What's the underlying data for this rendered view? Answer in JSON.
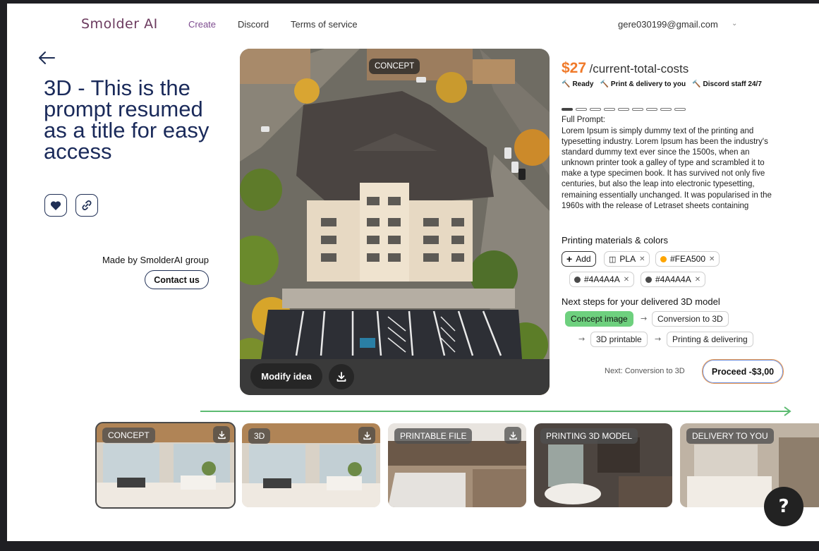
{
  "nav": {
    "logo": "Smolder AI",
    "links": [
      "Create",
      "Discord",
      "Terms of service"
    ],
    "user_email": "gere030199@gmail.com"
  },
  "project": {
    "title": "3D - This is the prompt resumed as a title for easy access",
    "made_by": "Made by SmolderAI group",
    "contact_label": "Contact us"
  },
  "hero": {
    "tag": "CONCEPT",
    "modify_label": "Modify idea"
  },
  "pricing": {
    "amount": "$27",
    "label": "/current-total-costs",
    "features": [
      "Ready",
      "Print & delivery to you",
      "Discord staff 24/7"
    ]
  },
  "prompt": {
    "label": "Full Prompt:",
    "text": "Lorem Ipsum is simply dummy text of the printing and typesetting industry. Lorem Ipsum has been the industry's standard dummy text ever since the 1500s, when an unknown printer took a galley of type and scrambled it to make a type specimen book. It has survived not only five centuries, but also the leap into electronic typesetting, remaining essentially unchanged. It was popularised in the 1960s with the release of Letraset sheets containing"
  },
  "materials": {
    "title": "Printing materials & colors",
    "add_label": "Add",
    "chips": [
      {
        "label": "PLA",
        "kind": "material"
      },
      {
        "label": "#FEA500",
        "color": "#FEA500"
      },
      {
        "label": "#4A4A4A",
        "color": "#4A4A4A"
      },
      {
        "label": "#4A4A4A",
        "color": "#4A4A4A"
      }
    ]
  },
  "steps": {
    "title": "Next steps for your delivered 3D model",
    "items": [
      "Concept image",
      "Conversion to 3D",
      "3D printable",
      "Printing & delivering"
    ],
    "active_index": 0,
    "next_label": "Next: Conversion to 3D",
    "proceed_label": "Proceed -$3,00"
  },
  "thumbnails": [
    {
      "label": "CONCEPT",
      "downloadable": true,
      "selected": true
    },
    {
      "label": "3D",
      "downloadable": true
    },
    {
      "label": "PRINTABLE FILE",
      "downloadable": true
    },
    {
      "label": "PRINTING 3D MODEL",
      "downloadable": false
    },
    {
      "label": "DELIVERY TO YOU",
      "downloadable": false
    }
  ],
  "help_label": "?",
  "colors": {
    "accent_orange": "#F07A2A",
    "active_step": "#6ED07E",
    "title_navy": "#1A2A5A",
    "progress_green": "#5DBB72"
  },
  "progress": {
    "dots_total": 9,
    "dots_active": 1
  }
}
